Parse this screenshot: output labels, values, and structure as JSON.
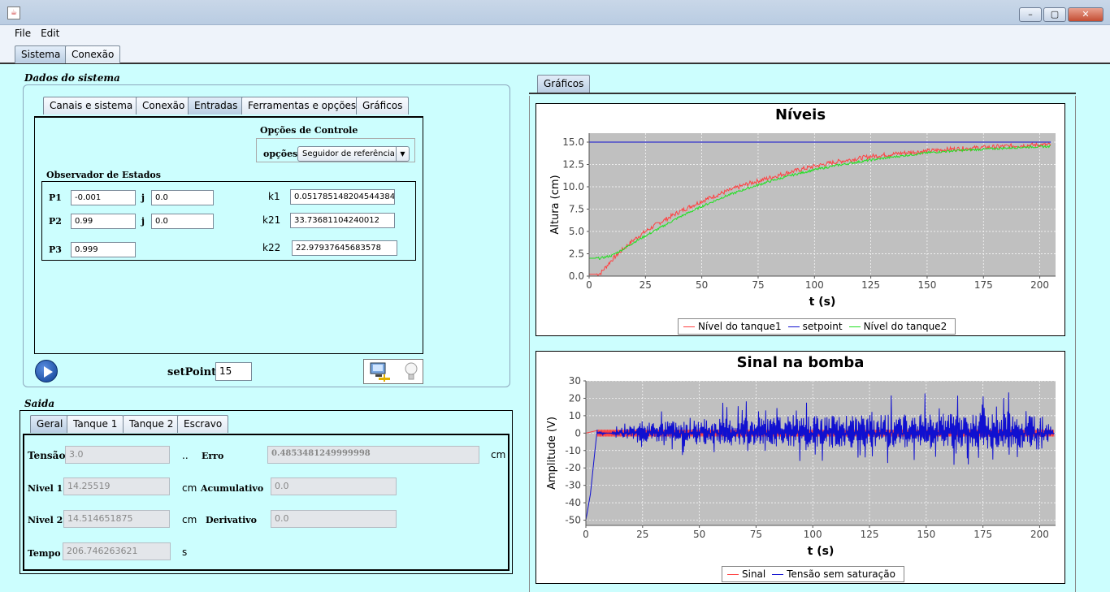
{
  "window": {
    "icon": "java-icon",
    "minimize": "–",
    "maximize": "▢",
    "close": "✕"
  },
  "menu": [
    "File",
    "Edit"
  ],
  "top_tabs": [
    "Sistema",
    "Conexão"
  ],
  "dados": {
    "title": "Dados do sistema",
    "tabs": [
      "Canais e sistema",
      "Conexão",
      "Entradas",
      "Ferramentas e opções",
      "Gráficos"
    ],
    "active_tab": "Entradas",
    "opcoes_controle_title": "Opções de Controle",
    "opcoes_label": "opções",
    "opcoes_value": "Seguidor de referência",
    "observador_title": "Observador de Estados",
    "p1_label": "P1",
    "p1_value": "-0.001",
    "j1_label": "j",
    "j1_value": "0.0",
    "p2_label": "P2",
    "p2_value": "0.99",
    "j2_label": "j",
    "j2_value": "0.0",
    "p3_label": "P3",
    "p3_value": "0.999",
    "k1_label": "k1",
    "k1_value": "0.051785148204544384",
    "k21_label": "k21",
    "k21_value": "33.73681104240012",
    "k22_label": "k22",
    "k22_value": "22.97937645683578",
    "setpoint_label": "setPoint",
    "setpoint_value": "15"
  },
  "saida": {
    "title": "Saida",
    "tabs": [
      "Geral",
      "Tanque 1",
      "Tanque 2",
      "Escravo"
    ],
    "active_tab": "Geral",
    "tensao_label": "Tensão",
    "tensao_value": "3.0",
    "tensao_dots": "..",
    "erro_label": "Erro",
    "erro_value": "0.4853481249999998",
    "erro_unit": "cm",
    "nivel1_label": "Nivel 1",
    "nivel1_value": "14.25519",
    "nivel1_unit": "cm",
    "acumulativo_label": "Acumulativo",
    "acumulativo_value": "0.0",
    "nivel2_label": "Nivel 2",
    "nivel2_value": "14.514651875",
    "nivel2_unit": "cm",
    "derivativo_label": "Derivativo",
    "derivativo_value": "0.0",
    "tempo_label": "Tempo",
    "tempo_value": "206.746263621",
    "tempo_unit": "s"
  },
  "graficos_tab": "Gráficos",
  "chart_data": [
    {
      "type": "line",
      "title": "Níveis",
      "xlabel": "t (s)",
      "ylabel": "Altura (cm)",
      "xlim": [
        0,
        207
      ],
      "ylim": [
        0,
        16
      ],
      "xticks": [
        0,
        25,
        50,
        75,
        100,
        125,
        150,
        175,
        200
      ],
      "yticks": [
        0.0,
        2.5,
        5.0,
        7.5,
        10.0,
        12.5,
        15.0
      ],
      "grid": true,
      "legend": "bottom",
      "series": [
        {
          "name": "Nível do tanque1",
          "color": "#ff4040",
          "x": [
            0,
            3,
            5,
            10,
            15,
            20,
            25,
            30,
            40,
            50,
            60,
            70,
            80,
            90,
            100,
            110,
            125,
            140,
            150,
            160,
            175,
            190,
            200,
            205
          ],
          "y": [
            0.2,
            0.2,
            0.3,
            1.8,
            3.0,
            4.1,
            5.0,
            5.8,
            7.2,
            8.4,
            9.4,
            10.3,
            11.0,
            11.7,
            12.3,
            12.8,
            13.4,
            13.8,
            14.0,
            14.2,
            14.4,
            14.6,
            14.7,
            14.7
          ]
        },
        {
          "name": "setpoint",
          "color": "#1010d0",
          "x": [
            0,
            205
          ],
          "y": [
            15,
            15
          ]
        },
        {
          "name": "Nível do tanque2",
          "color": "#20e020",
          "x": [
            0,
            5,
            10,
            15,
            20,
            25,
            30,
            40,
            50,
            60,
            70,
            80,
            90,
            100,
            110,
            125,
            140,
            150,
            160,
            175,
            190,
            200,
            205
          ],
          "y": [
            2.0,
            2.0,
            2.3,
            3.0,
            3.8,
            4.5,
            5.2,
            6.6,
            7.8,
            8.9,
            9.8,
            10.6,
            11.3,
            11.9,
            12.4,
            13.0,
            13.5,
            13.8,
            14.0,
            14.2,
            14.4,
            14.5,
            14.5
          ]
        }
      ]
    },
    {
      "type": "line",
      "title": "Sinal na bomba",
      "xlabel": "t (s)",
      "ylabel": "Amplitude (V)",
      "xlim": [
        0,
        207
      ],
      "ylim": [
        -53,
        30
      ],
      "xticks": [
        0,
        25,
        50,
        75,
        100,
        125,
        150,
        175,
        200
      ],
      "yticks": [
        -50,
        -40,
        -30,
        -20,
        -10,
        0,
        10,
        20,
        30
      ],
      "grid": true,
      "legend": "bottom",
      "series": [
        {
          "name": "Sinal",
          "color": "#ff4040",
          "x": [
            0,
            5,
            207
          ],
          "y": [
            0,
            1.5,
            1.5
          ]
        },
        {
          "name": "Tensão sem saturação",
          "color": "#1010d0",
          "x": [
            0,
            2,
            4,
            5,
            10,
            20,
            50,
            100,
            150,
            200,
            207
          ],
          "y": [
            -50,
            -35,
            -10,
            2,
            0,
            10,
            15,
            18,
            20,
            22,
            0
          ]
        }
      ]
    }
  ]
}
